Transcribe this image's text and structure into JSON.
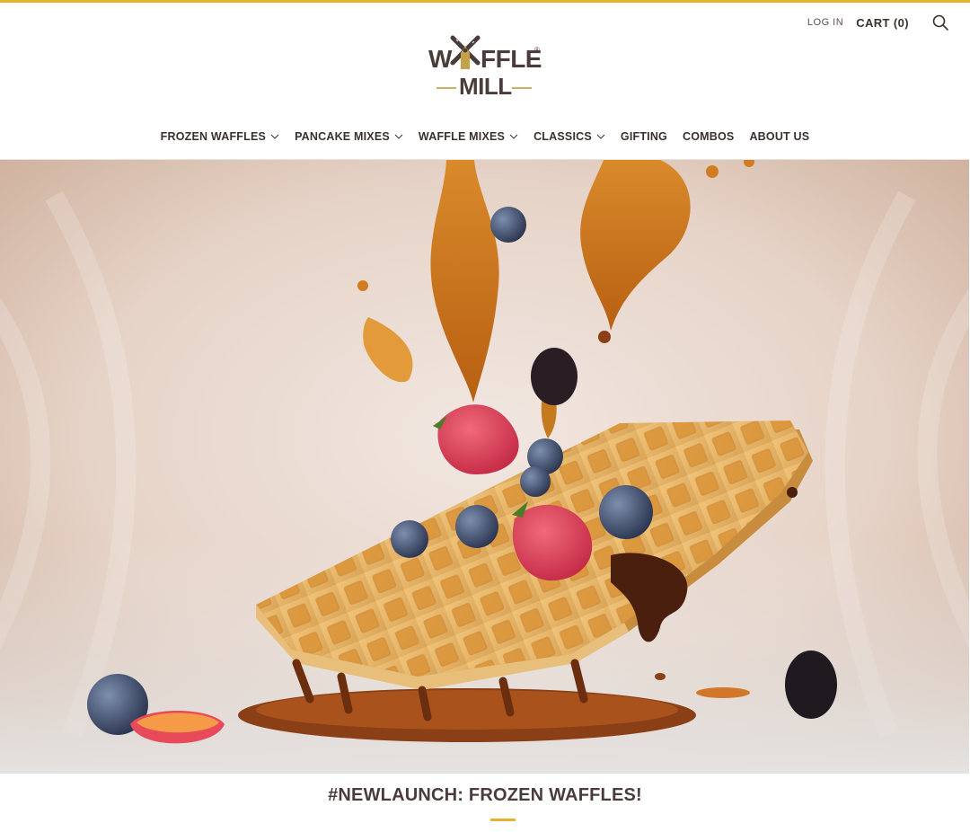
{
  "header": {
    "login_label": "LOG IN",
    "cart_label": "CART (0)",
    "search_icon": "search-icon"
  },
  "logo": {
    "line1_w": "W",
    "line1_rest": "FFLE",
    "line2": "MILL",
    "registered": "®",
    "icon": "windmill-icon"
  },
  "nav": {
    "items": [
      {
        "label": "FROZEN WAFFLES",
        "has_dropdown": true
      },
      {
        "label": "PANCAKE MIXES",
        "has_dropdown": true
      },
      {
        "label": "WAFFLE MIXES",
        "has_dropdown": true
      },
      {
        "label": "CLASSICS",
        "has_dropdown": true
      },
      {
        "label": "GIFTING",
        "has_dropdown": false
      },
      {
        "label": "COMBOS",
        "has_dropdown": false
      },
      {
        "label": "ABOUT US",
        "has_dropdown": false
      }
    ]
  },
  "section": {
    "title": "#NEWLAUNCH: FROZEN WAFFLES!"
  },
  "colors": {
    "accent": "#e0b52c",
    "brand_text": "#4b3c3c",
    "syrup": "#c4701a",
    "waffle": "#e8b86a"
  }
}
